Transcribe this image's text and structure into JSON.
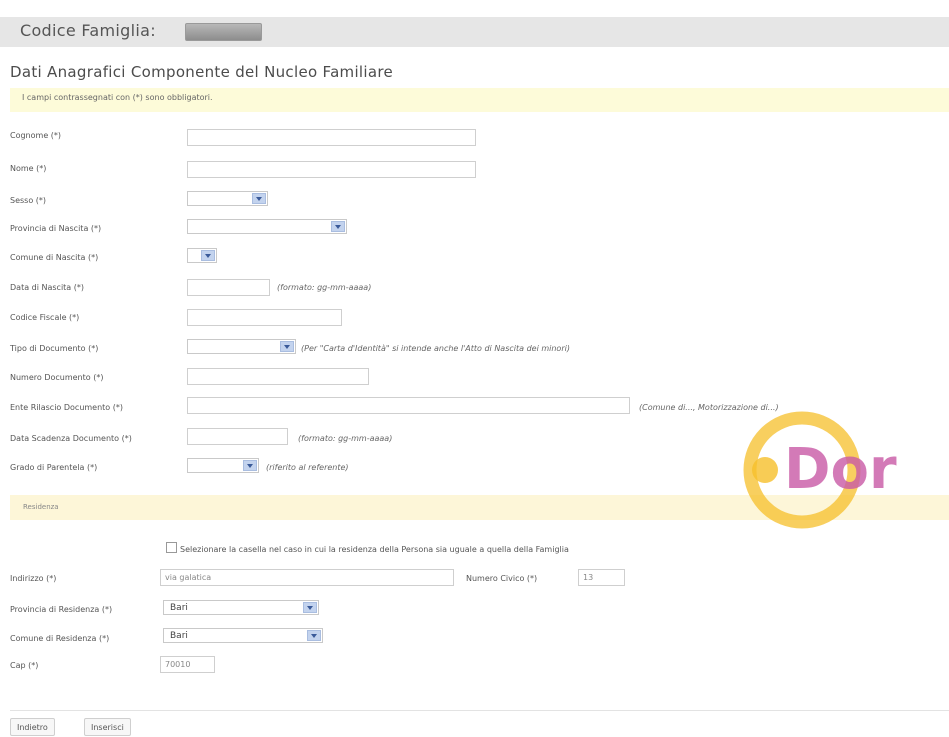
{
  "header": {
    "title": "Codice Famiglia:"
  },
  "section_title": "Dati Anagrafici Componente del Nucleo Familiare",
  "notice": "I campi contrassegnati con (*) sono obbligatori.",
  "fields": {
    "cognome": {
      "label": "Cognome (*)",
      "value": ""
    },
    "nome": {
      "label": "Nome (*)",
      "value": ""
    },
    "sesso": {
      "label": "Sesso (*)",
      "value": ""
    },
    "provincia_nascita": {
      "label": "Provincia di Nascita (*)",
      "value": ""
    },
    "comune_nascita": {
      "label": "Comune di Nascita (*)",
      "value": ""
    },
    "data_nascita": {
      "label": "Data di Nascita (*)",
      "value": "",
      "hint": "(formato: gg-mm-aaaa)"
    },
    "codice_fiscale": {
      "label": "Codice Fiscale (*)",
      "value": ""
    },
    "tipo_documento": {
      "label": "Tipo di Documento (*)",
      "value": "",
      "hint": "(Per \"Carta d'Identità\" si intende anche l'Atto di Nascita dei minori)"
    },
    "numero_documento": {
      "label": "Numero Documento (*)",
      "value": ""
    },
    "ente_rilascio": {
      "label": "Ente Rilascio Documento (*)",
      "value": "",
      "hint": "(Comune di..., Motorizzazione di...)"
    },
    "data_scadenza": {
      "label": "Data Scadenza Documento (*)",
      "value": "",
      "hint": "(formato: gg-mm-aaaa)"
    },
    "grado_parentela": {
      "label": "Grado di Parentela (*)",
      "value": "",
      "hint": "(riferito al referente)"
    }
  },
  "residenza": {
    "section_label": "Residenza",
    "checkbox_label": "Selezionare la casella nel caso in cui la residenza della Persona sia uguale a quella della Famiglia",
    "indirizzo": {
      "label": "Indirizzo (*)",
      "value": "via galatica"
    },
    "numero_civico": {
      "label": "Numero Civico (*)",
      "value": "13"
    },
    "provincia": {
      "label": "Provincia di Residenza (*)",
      "value": "Bari"
    },
    "comune": {
      "label": "Comune di Residenza (*)",
      "value": "Bari"
    },
    "cap": {
      "label": "Cap (*)",
      "value": "70010"
    }
  },
  "buttons": {
    "back": "Indietro",
    "insert": "Inserisci"
  },
  "watermark": {
    "text": "Dor",
    "ring_color": "#f6bf2a",
    "text_color": "#c95aa6"
  }
}
